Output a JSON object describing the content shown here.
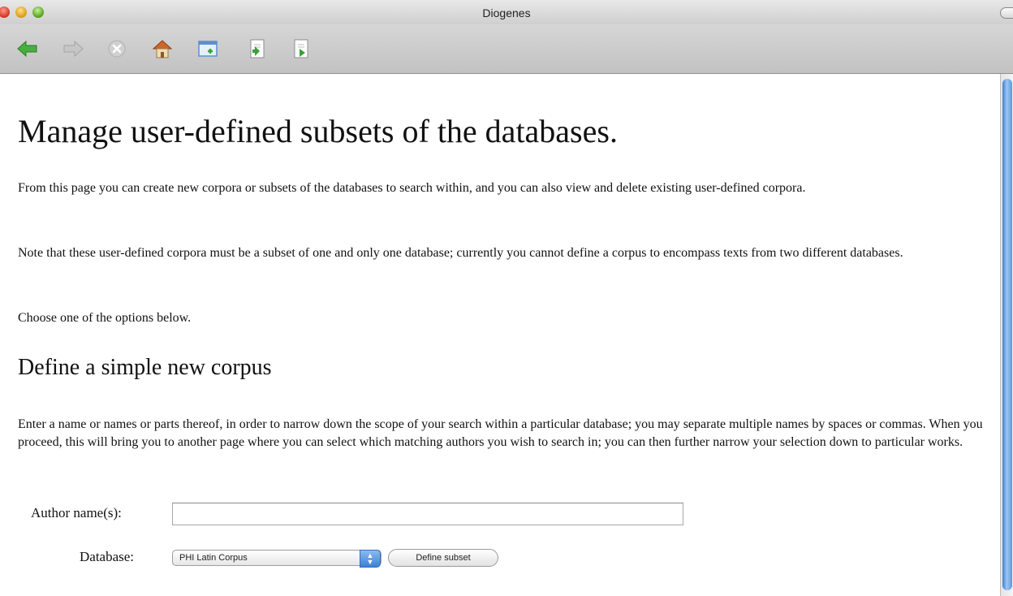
{
  "window": {
    "title": "Diogenes"
  },
  "toolbar": {
    "buttons": [
      {
        "name": "back",
        "icon": "back-arrow-icon",
        "color": "#3faa3c"
      },
      {
        "name": "forward",
        "icon": "forward-arrow-icon",
        "color": "#b7b7b7"
      },
      {
        "name": "stop",
        "icon": "stop-icon",
        "color": "#bdbdbd"
      },
      {
        "name": "home",
        "icon": "home-icon",
        "color": "#c86a2a"
      },
      {
        "name": "new-window",
        "icon": "new-window-icon",
        "color": "#3a7fd0"
      },
      {
        "name": "open",
        "icon": "open-icon",
        "color": "#3a9f3a"
      },
      {
        "name": "save",
        "icon": "save-icon",
        "color": "#3a9f3a"
      }
    ]
  },
  "page": {
    "heading": "Manage user-defined subsets of the databases.",
    "intro": "From this page you can create new corpora or subsets of the databases to search within, and you can also view and delete existing user-defined corpora.",
    "note": "Note that these user-defined corpora must be a subset of one and only one database; currently you cannot define a corpus to encompass texts from two different databases.",
    "choose": "Choose one of the options below.",
    "section_heading": "Define a simple new corpus",
    "section_text": "Enter a name or names or parts thereof, in order to narrow down the scope of your search within a particular database; you may separate multiple names by spaces or commas. When you proceed, this will bring you to another page where you can select which matching authors you wish to search in; you can then further narrow your selection down to particular works."
  },
  "form": {
    "author_label": "Author name(s):",
    "author_value": "",
    "database_label": "Database:",
    "database_selected": "PHI Latin Corpus",
    "define_button": "Define subset"
  }
}
